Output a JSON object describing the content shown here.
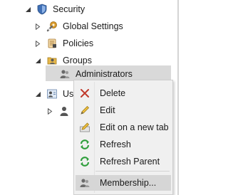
{
  "tree": {
    "items": [
      {
        "label": "Security",
        "expanded": true,
        "icon": "shield-icon"
      },
      {
        "label": "Global Settings",
        "expanded": false,
        "icon": "global-settings-icon"
      },
      {
        "label": "Policies",
        "expanded": false,
        "icon": "policies-icon"
      },
      {
        "label": "Groups",
        "expanded": true,
        "icon": "groups-icon"
      },
      {
        "label": "Administrators",
        "selected": true,
        "icon": "user-group-icon"
      },
      {
        "label": "Use",
        "expanded": true,
        "icon": "users-icon"
      },
      {
        "label": "",
        "expanded": false,
        "icon": "user-icon"
      }
    ]
  },
  "context_menu": {
    "items": [
      {
        "label": "Delete",
        "icon": "delete-icon"
      },
      {
        "label": "Edit",
        "icon": "edit-icon"
      },
      {
        "label": "Edit on a new tab",
        "icon": "edit-new-tab-icon"
      },
      {
        "label": "Refresh",
        "icon": "refresh-icon"
      },
      {
        "label": "Refresh Parent",
        "icon": "refresh-parent-icon"
      },
      {
        "label": "Membership...",
        "icon": "membership-icon",
        "highlighted": true
      }
    ]
  },
  "colors": {
    "selection": "#d9d9d9",
    "menu_background": "#f0f0f0",
    "menu_hover": "#d6d6d6",
    "delete_red": "#c0392b",
    "refresh_green": "#2e9e3b"
  }
}
